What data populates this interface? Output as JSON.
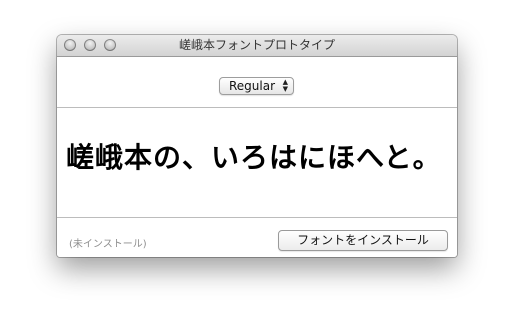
{
  "window": {
    "title": "嵯峨本フォントプロトタイプ"
  },
  "toolbar": {
    "style_select": {
      "selected": "Regular",
      "arrows_icon": "up-down-arrows-icon"
    }
  },
  "preview": {
    "sample_text": "嵯峨本の、いろはにほへと。"
  },
  "footer": {
    "status": "(未インストール)",
    "install_button_label": "フォントをインストール"
  }
}
